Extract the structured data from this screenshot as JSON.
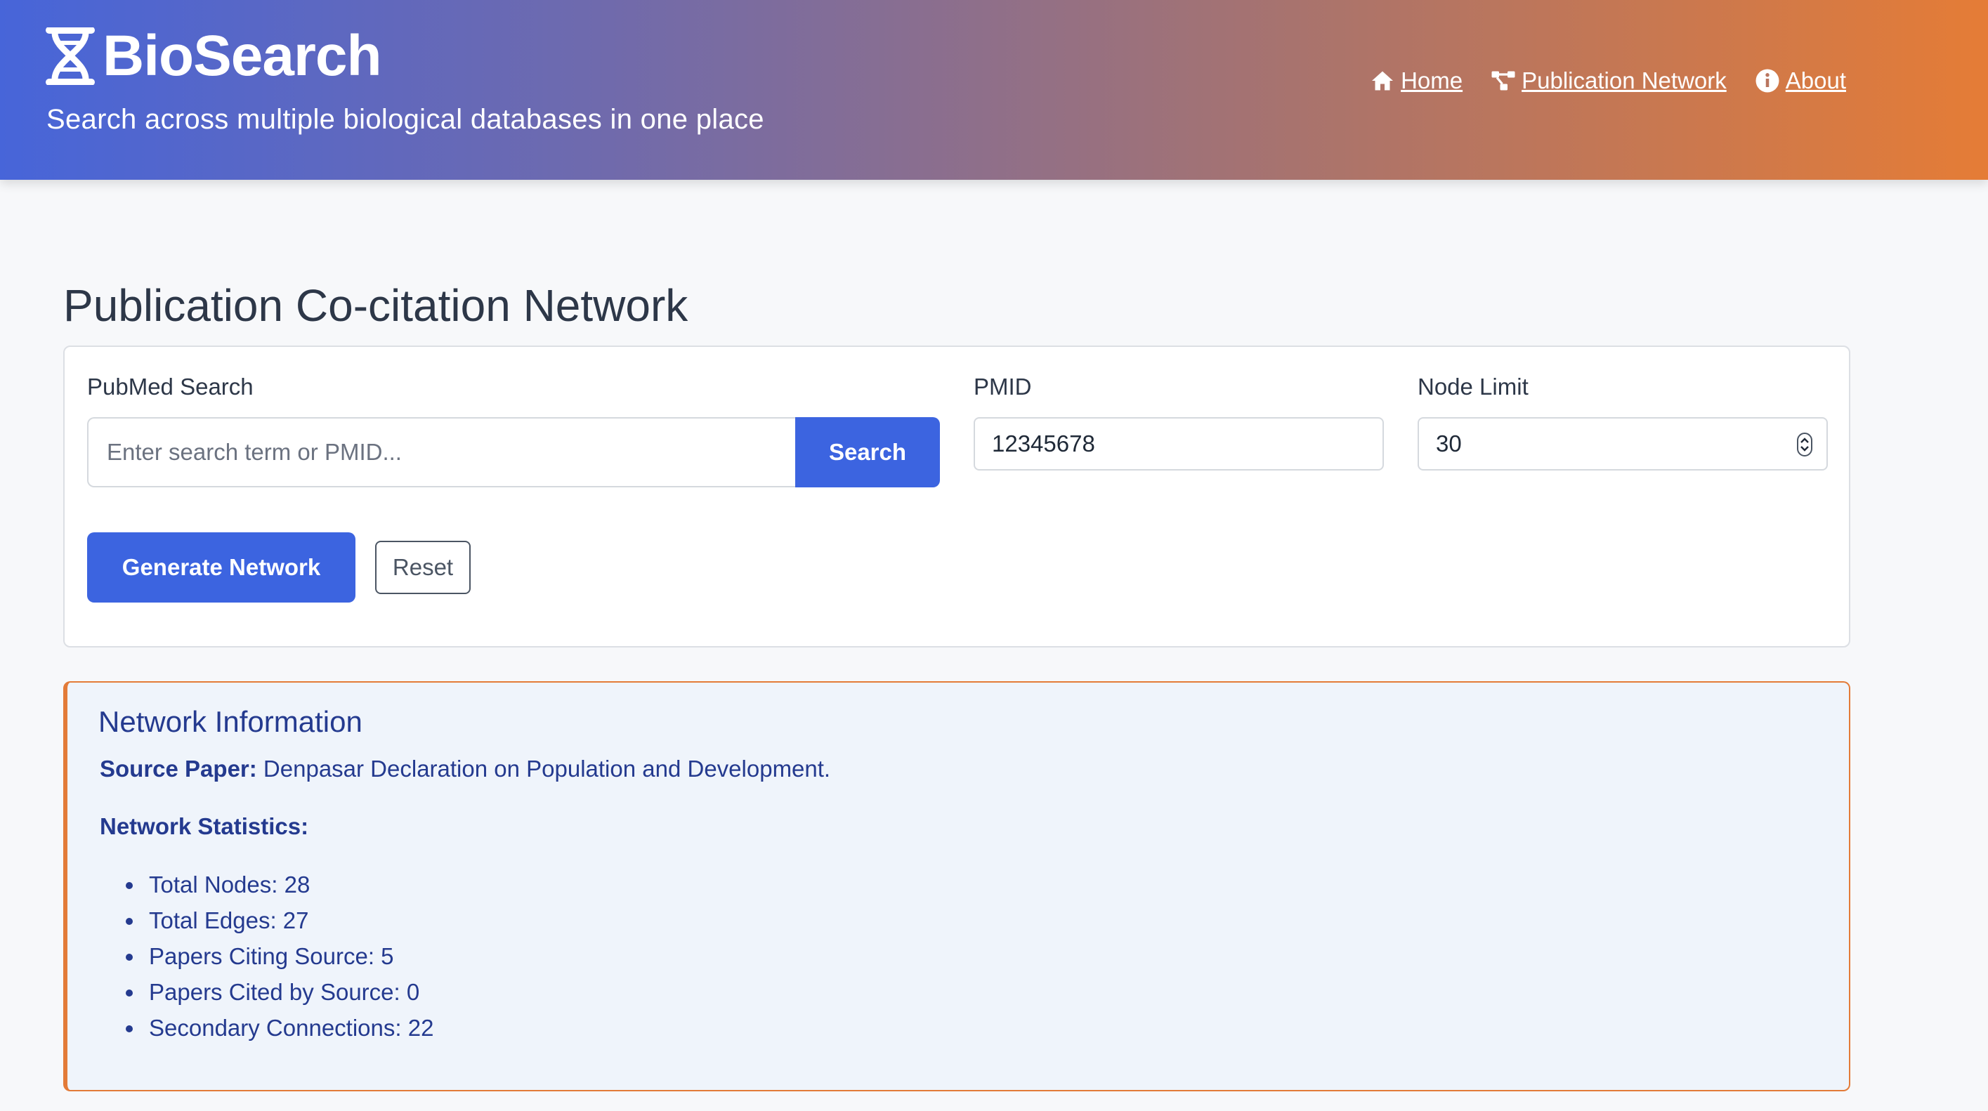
{
  "header": {
    "brand": "BioSearch",
    "tagline": "Search across multiple biological databases in one place",
    "nav": [
      {
        "label": "Home",
        "icon": "home-icon"
      },
      {
        "label": "Publication Network",
        "icon": "network-icon"
      },
      {
        "label": "About",
        "icon": "info-icon"
      }
    ]
  },
  "page": {
    "title": "Publication Co-citation Network"
  },
  "form": {
    "pubmed_label": "PubMed Search",
    "search_placeholder": "Enter search term or PMID...",
    "search_button": "Search",
    "pmid_label": "PMID",
    "pmid_value": "12345678",
    "node_limit_label": "Node Limit",
    "node_limit_value": "30",
    "generate_button": "Generate Network",
    "reset_button": "Reset"
  },
  "network_info": {
    "title": "Network Information",
    "source_label": "Source Paper:",
    "source_value": "Denpasar Declaration on Population and Development.",
    "stats_label": "Network Statistics:",
    "stats": [
      "Total Nodes: 28",
      "Total Edges: 27",
      "Papers Citing Source: 5",
      "Papers Cited by Source: 0",
      "Secondary Connections: 22"
    ]
  },
  "colors": {
    "primary": "#3c64e0",
    "accent_orange": "#e37b38",
    "info_text": "#243a8f",
    "info_bg": "#eff4fb"
  }
}
